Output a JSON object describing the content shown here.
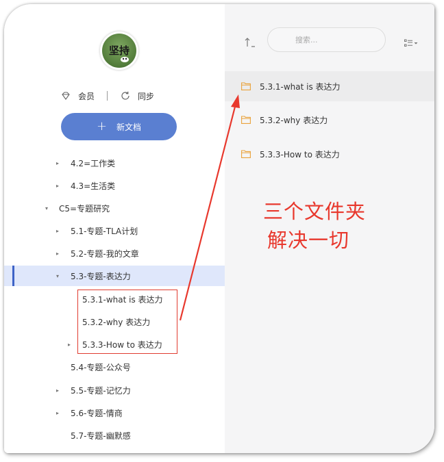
{
  "sidebar": {
    "avatar_text": "坚持",
    "member_label": "会员",
    "sync_label": "同步",
    "new_doc_label": "新文档",
    "tree": [
      {
        "label": "4.2=工作类",
        "arrow": "▸"
      },
      {
        "label": "4.3=生活类",
        "arrow": "▸"
      },
      {
        "label": "C5=专题研究",
        "arrow": "▾"
      },
      {
        "label": "5.1-专题-TLA计划",
        "arrow": "▸"
      },
      {
        "label": "5.2-专题-我的文章",
        "arrow": "▸"
      },
      {
        "label": "5.3-专题-表达力",
        "arrow": "▾"
      },
      {
        "label": "5.3.1-what is 表达力",
        "arrow": ""
      },
      {
        "label": "5.3.2-why 表达力",
        "arrow": ""
      },
      {
        "label": "5.3.3-How to 表达力",
        "arrow": "▸"
      },
      {
        "label": "5.4-专题-公众号",
        "arrow": ""
      },
      {
        "label": "5.5-专题-记忆力",
        "arrow": "▸"
      },
      {
        "label": "5.6-专题-情商",
        "arrow": "▸"
      },
      {
        "label": "5.7-专题-幽默感",
        "arrow": ""
      }
    ]
  },
  "content": {
    "search_placeholder": "搜索...",
    "folders": [
      {
        "name": "5.3.1-what is 表达力"
      },
      {
        "name": "5.3.2-why 表达力"
      },
      {
        "name": "5.3.3-How to 表达力"
      }
    ],
    "annotation_line1": "三个文件夹",
    "annotation_line2": "解决一切"
  },
  "colors": {
    "accent": "#5a7fd1",
    "selected_bg": "#dfe7fb",
    "annotation_red": "#e8382d",
    "folder_orange": "#e9a23b"
  }
}
